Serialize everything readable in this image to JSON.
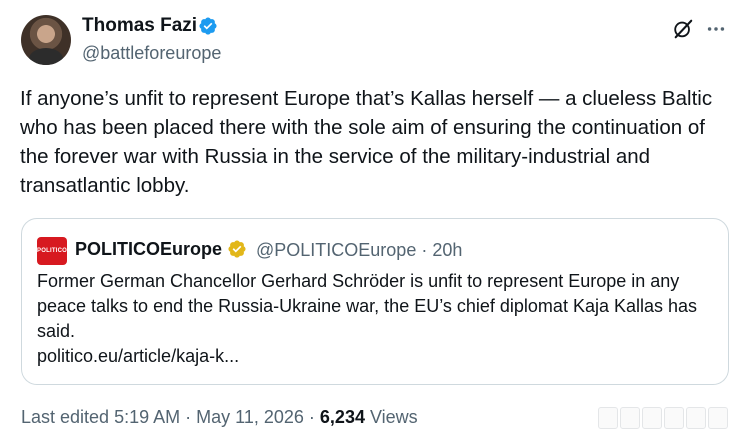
{
  "author": {
    "name": "Thomas Fazi",
    "handle": "@battleforeurope"
  },
  "tweet": {
    "text": "If anyone’s unfit to represent Europe that’s Kallas herself — a clueless Baltic who has been placed there with the sole aim of ensuring the continuation of the forever war with Russia in the service of the military-industrial and transatlantic lobby."
  },
  "quoted": {
    "avatar_label": "POLITICO",
    "name": "POLITICOEurope",
    "handle": "@POLITICOEurope",
    "separator": "·",
    "time": "20h",
    "text": "Former German Chancellor Gerhard Schröder is unfit to represent Europe in any peace talks to end the Russia-Ukraine war, the EU’s chief diplomat Kaja Kallas has said.",
    "link": "politico.eu/article/kaja-k..."
  },
  "footer": {
    "edited": "Last edited 5:19 AM",
    "separator": "·",
    "date": "May 11, 2026",
    "views_count": "6,234",
    "views_label": "Views"
  },
  "icons": {
    "verified": "verified-badge-icon",
    "quoted_badge": "gold-verified-badge-icon",
    "grok": "grok-icon",
    "more": "more-icon"
  },
  "colors": {
    "verified_blue": "#1d9bf0",
    "gold_badge": "#e2b719",
    "politico_red": "#d71920",
    "secondary_text": "#536471",
    "border": "#cfd9de"
  }
}
